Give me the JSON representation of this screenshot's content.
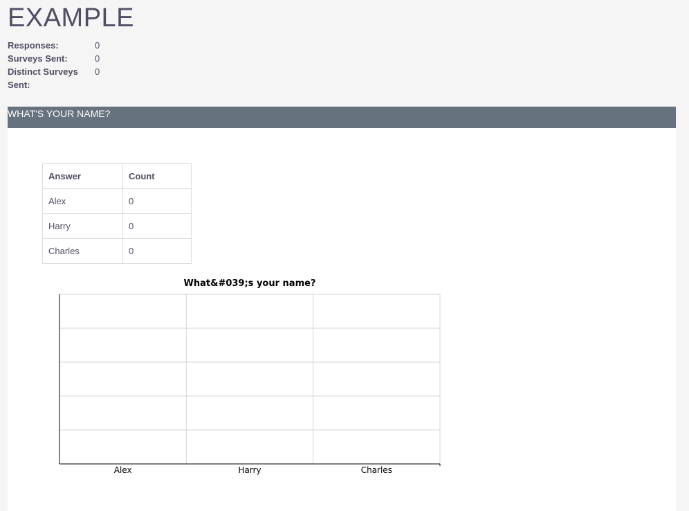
{
  "page": {
    "title": "EXAMPLE"
  },
  "stats": [
    {
      "label": "Responses:",
      "value": "0"
    },
    {
      "label": "Surveys Sent:",
      "value": "0"
    },
    {
      "label": "Distinct Surveys Sent:",
      "value": "0"
    }
  ],
  "question": {
    "header": "WHAT'S YOUR NAME?",
    "table": {
      "headers": [
        "Answer",
        "Count"
      ],
      "rows": [
        {
          "answer": "Alex",
          "count": "0"
        },
        {
          "answer": "Harry",
          "count": "0"
        },
        {
          "answer": "Charles",
          "count": "0"
        }
      ]
    }
  },
  "chart_data": {
    "type": "bar",
    "title": "What&#039;s your name?",
    "categories": [
      "Alex",
      "Harry",
      "Charles"
    ],
    "values": [
      0,
      0,
      0
    ],
    "grid": true
  }
}
